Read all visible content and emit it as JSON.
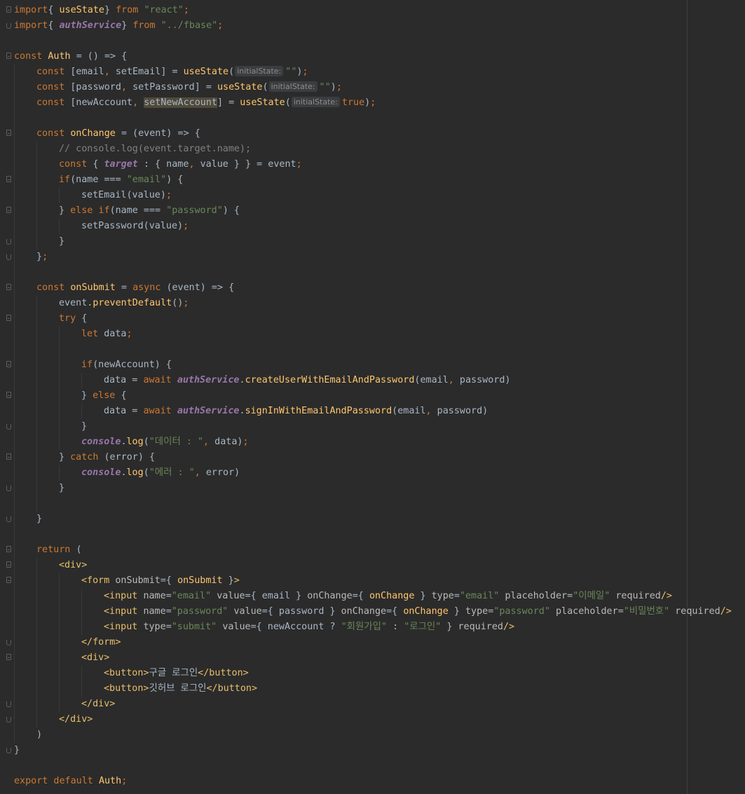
{
  "editor": {
    "lines": [
      {
        "g": "o",
        "i": 0,
        "t": [
          [
            "kw",
            "import"
          ],
          [
            "",
            "{ "
          ],
          [
            "fn",
            "useState"
          ],
          [
            "",
            "} "
          ],
          [
            "kw",
            "from "
          ],
          [
            "str",
            "\"react\""
          ],
          [
            "kw",
            ";"
          ]
        ]
      },
      {
        "g": "c",
        "i": 0,
        "t": [
          [
            "kw",
            "import"
          ],
          [
            "",
            "{ "
          ],
          [
            "svc",
            "authService"
          ],
          [
            "",
            "} "
          ],
          [
            "kw",
            "from "
          ],
          [
            "str",
            "\"../fbase\""
          ],
          [
            "kw",
            ";"
          ]
        ]
      },
      {
        "g": "",
        "i": 0,
        "t": []
      },
      {
        "g": "o",
        "i": 0,
        "t": [
          [
            "kw",
            "const "
          ],
          [
            "fn",
            "Auth "
          ],
          [
            "",
            "= () => {"
          ]
        ]
      },
      {
        "g": "",
        "i": 1,
        "t": [
          [
            "kw",
            "const "
          ],
          [
            "",
            "[email"
          ],
          [
            "kw",
            ", "
          ],
          [
            "",
            "setEmail] = "
          ],
          [
            "fn",
            "useState"
          ],
          [
            "",
            "("
          ],
          [
            "hint",
            "initialState:"
          ],
          [
            "str",
            "\"\""
          ],
          [
            "",
            ")"
          ],
          [
            "kw",
            ";"
          ]
        ]
      },
      {
        "g": "",
        "i": 1,
        "t": [
          [
            "kw",
            "const "
          ],
          [
            "",
            "[password"
          ],
          [
            "kw",
            ", "
          ],
          [
            "",
            "setPassword] = "
          ],
          [
            "fn",
            "useState"
          ],
          [
            "",
            "("
          ],
          [
            "hint",
            "initialState:"
          ],
          [
            "str",
            "\"\""
          ],
          [
            "",
            ")"
          ],
          [
            "kw",
            ";"
          ]
        ]
      },
      {
        "g": "",
        "i": 1,
        "t": [
          [
            "kw",
            "const "
          ],
          [
            "",
            "[newAccount"
          ],
          [
            "kw",
            ", "
          ],
          [
            "hl",
            "setNewAccount"
          ],
          [
            "",
            "] = "
          ],
          [
            "fn",
            "useState"
          ],
          [
            "",
            "("
          ],
          [
            "hint",
            "initialState:"
          ],
          [
            "kw",
            "true"
          ],
          [
            "",
            ")"
          ],
          [
            "kw",
            ";"
          ]
        ]
      },
      {
        "g": "",
        "i": 1,
        "t": []
      },
      {
        "g": "o",
        "i": 1,
        "t": [
          [
            "kw",
            "const "
          ],
          [
            "fn",
            "onChange "
          ],
          [
            "",
            "= (event) => {"
          ]
        ]
      },
      {
        "g": "",
        "i": 2,
        "t": [
          [
            "cmt",
            "// console.log(event.target.name);"
          ]
        ]
      },
      {
        "g": "",
        "i": 2,
        "t": [
          [
            "kw",
            "const "
          ],
          [
            "",
            "{ "
          ],
          [
            "svc2",
            "target "
          ],
          [
            "",
            ": { name"
          ],
          [
            "kw",
            ", "
          ],
          [
            "",
            "value } } = event"
          ],
          [
            "kw",
            ";"
          ]
        ]
      },
      {
        "g": "o",
        "i": 2,
        "t": [
          [
            "kw",
            "if"
          ],
          [
            "",
            "(name === "
          ],
          [
            "str",
            "\"email\""
          ],
          [
            "",
            ") {"
          ]
        ]
      },
      {
        "g": "",
        "i": 3,
        "t": [
          [
            "",
            "setEmail(value)"
          ],
          [
            "kw",
            ";"
          ]
        ]
      },
      {
        "g": "o",
        "i": 2,
        "t": [
          [
            "",
            "} "
          ],
          [
            "kw",
            "else if"
          ],
          [
            "",
            "(name === "
          ],
          [
            "str",
            "\"password\""
          ],
          [
            "",
            ") {"
          ]
        ]
      },
      {
        "g": "",
        "i": 3,
        "t": [
          [
            "",
            "setPassword(value)"
          ],
          [
            "kw",
            ";"
          ]
        ]
      },
      {
        "g": "c",
        "i": 2,
        "t": [
          [
            "",
            "}"
          ]
        ]
      },
      {
        "g": "c",
        "i": 1,
        "t": [
          [
            "",
            "}"
          ],
          [
            "kw",
            ";"
          ]
        ]
      },
      {
        "g": "",
        "i": 1,
        "t": []
      },
      {
        "g": "o",
        "i": 1,
        "t": [
          [
            "kw",
            "const "
          ],
          [
            "fn",
            "onSubmit "
          ],
          [
            "",
            "= "
          ],
          [
            "kw",
            "async "
          ],
          [
            "",
            "(event) => {"
          ]
        ]
      },
      {
        "g": "",
        "i": 2,
        "t": [
          [
            "",
            "event."
          ],
          [
            "fn",
            "preventDefault"
          ],
          [
            "",
            "()"
          ],
          [
            "kw",
            ";"
          ]
        ]
      },
      {
        "g": "o",
        "i": 2,
        "t": [
          [
            "kw",
            "try "
          ],
          [
            "",
            "{"
          ]
        ]
      },
      {
        "g": "",
        "i": 3,
        "t": [
          [
            "kw",
            "let "
          ],
          [
            "",
            "data"
          ],
          [
            "kw",
            ";"
          ]
        ]
      },
      {
        "g": "",
        "i": 3,
        "t": []
      },
      {
        "g": "o",
        "i": 3,
        "t": [
          [
            "kw",
            "if"
          ],
          [
            "",
            "(newAccount) {"
          ]
        ]
      },
      {
        "g": "",
        "i": 4,
        "t": [
          [
            "",
            "data = "
          ],
          [
            "kw",
            "await "
          ],
          [
            "svc",
            "authService"
          ],
          [
            "",
            "."
          ],
          [
            "fn",
            "createUserWithEmailAndPassword"
          ],
          [
            "",
            "(email"
          ],
          [
            "kw",
            ", "
          ],
          [
            "",
            "password)"
          ]
        ]
      },
      {
        "g": "o",
        "i": 3,
        "t": [
          [
            "",
            "} "
          ],
          [
            "kw",
            "else "
          ],
          [
            "",
            "{"
          ]
        ]
      },
      {
        "g": "",
        "i": 4,
        "t": [
          [
            "",
            "data = "
          ],
          [
            "kw",
            "await "
          ],
          [
            "svc",
            "authService"
          ],
          [
            "",
            "."
          ],
          [
            "fn",
            "signInWithEmailAndPassword"
          ],
          [
            "",
            "(email"
          ],
          [
            "kw",
            ", "
          ],
          [
            "",
            "password)"
          ]
        ]
      },
      {
        "g": "c",
        "i": 3,
        "t": [
          [
            "",
            "}"
          ]
        ]
      },
      {
        "g": "",
        "i": 3,
        "t": [
          [
            "svc",
            "console"
          ],
          [
            "",
            "."
          ],
          [
            "fn",
            "log"
          ],
          [
            "",
            "("
          ],
          [
            "str",
            "\"데이터 : \""
          ],
          [
            "kw",
            ", "
          ],
          [
            "",
            "data)"
          ],
          [
            "kw",
            ";"
          ]
        ]
      },
      {
        "g": "o",
        "i": 2,
        "t": [
          [
            "",
            "} "
          ],
          [
            "kw",
            "catch "
          ],
          [
            "",
            "(error) {"
          ]
        ]
      },
      {
        "g": "",
        "i": 3,
        "t": [
          [
            "svc",
            "console"
          ],
          [
            "",
            "."
          ],
          [
            "fn",
            "log"
          ],
          [
            "",
            "("
          ],
          [
            "str",
            "\"에러 : \""
          ],
          [
            "kw",
            ", "
          ],
          [
            "",
            "error)"
          ]
        ]
      },
      {
        "g": "c",
        "i": 2,
        "t": [
          [
            "",
            "}"
          ]
        ]
      },
      {
        "g": "",
        "i": 2,
        "t": []
      },
      {
        "g": "c",
        "i": 1,
        "t": [
          [
            "",
            "}"
          ]
        ]
      },
      {
        "g": "",
        "i": 1,
        "t": []
      },
      {
        "g": "o",
        "i": 1,
        "t": [
          [
            "kw",
            "return "
          ],
          [
            "",
            "("
          ]
        ]
      },
      {
        "g": "o",
        "i": 2,
        "t": [
          [
            "tag",
            "<div>"
          ]
        ]
      },
      {
        "g": "o",
        "i": 3,
        "t": [
          [
            "tag",
            "<form "
          ],
          [
            "attr",
            "onSubmit"
          ],
          [
            "",
            "={ "
          ],
          [
            "fn",
            "onSubmit "
          ],
          [
            "",
            "}"
          ],
          [
            "tag",
            ">"
          ]
        ]
      },
      {
        "g": "",
        "i": 4,
        "t": [
          [
            "tag",
            "<input "
          ],
          [
            "attr",
            "name"
          ],
          [
            "",
            "="
          ],
          [
            "str",
            "\"email\" "
          ],
          [
            "attr",
            "value"
          ],
          [
            "",
            "={ email } "
          ],
          [
            "attr",
            "onChange"
          ],
          [
            "",
            "={ "
          ],
          [
            "fn",
            "onChange "
          ],
          [
            "",
            "} "
          ],
          [
            "attr",
            "type"
          ],
          [
            "",
            "="
          ],
          [
            "str",
            "\"email\" "
          ],
          [
            "attr",
            "placeholder"
          ],
          [
            "",
            "="
          ],
          [
            "str",
            "\"이메일\" "
          ],
          [
            "attr",
            "required"
          ],
          [
            "tag",
            "/>"
          ]
        ]
      },
      {
        "g": "",
        "i": 4,
        "t": [
          [
            "tag",
            "<input "
          ],
          [
            "attr",
            "name"
          ],
          [
            "",
            "="
          ],
          [
            "str",
            "\"password\" "
          ],
          [
            "attr",
            "value"
          ],
          [
            "",
            "={ password } "
          ],
          [
            "attr",
            "onChange"
          ],
          [
            "",
            "={ "
          ],
          [
            "fn",
            "onChange "
          ],
          [
            "",
            "} "
          ],
          [
            "attr",
            "type"
          ],
          [
            "",
            "="
          ],
          [
            "str",
            "\"password\" "
          ],
          [
            "attr",
            "placeholder"
          ],
          [
            "",
            "="
          ],
          [
            "str",
            "\"비밀번호\" "
          ],
          [
            "attr",
            "required"
          ],
          [
            "tag",
            "/>"
          ]
        ]
      },
      {
        "g": "",
        "i": 4,
        "t": [
          [
            "tag",
            "<input "
          ],
          [
            "attr",
            "type"
          ],
          [
            "",
            "="
          ],
          [
            "str",
            "\"submit\" "
          ],
          [
            "attr",
            "value"
          ],
          [
            "",
            "={ newAccount ? "
          ],
          [
            "str",
            "\"회원가입\" "
          ],
          [
            "",
            ": "
          ],
          [
            "str",
            "\"로그인\" "
          ],
          [
            "",
            "} "
          ],
          [
            "attr",
            "required"
          ],
          [
            "tag",
            "/>"
          ]
        ]
      },
      {
        "g": "c",
        "i": 3,
        "t": [
          [
            "tag",
            "</form>"
          ]
        ]
      },
      {
        "g": "o",
        "i": 3,
        "t": [
          [
            "tag",
            "<div>"
          ]
        ]
      },
      {
        "g": "",
        "i": 4,
        "t": [
          [
            "tag",
            "<button>"
          ],
          [
            "",
            "구글 로그인"
          ],
          [
            "tag",
            "</button>"
          ]
        ]
      },
      {
        "g": "",
        "i": 4,
        "t": [
          [
            "tag",
            "<button>"
          ],
          [
            "",
            "깃허브 로그인"
          ],
          [
            "tag",
            "</button>"
          ]
        ]
      },
      {
        "g": "c",
        "i": 3,
        "t": [
          [
            "tag",
            "</div>"
          ]
        ]
      },
      {
        "g": "c",
        "i": 2,
        "t": [
          [
            "tag",
            "</div>"
          ]
        ]
      },
      {
        "g": "",
        "i": 1,
        "t": [
          [
            "",
            ")"
          ]
        ]
      },
      {
        "g": "c",
        "i": 0,
        "t": [
          [
            "",
            "}"
          ]
        ]
      },
      {
        "g": "",
        "i": 0,
        "t": []
      },
      {
        "g": "",
        "i": 0,
        "t": [
          [
            "kw",
            "export default "
          ],
          [
            "fn",
            "Auth"
          ],
          [
            "kw",
            ";"
          ]
        ]
      }
    ]
  }
}
